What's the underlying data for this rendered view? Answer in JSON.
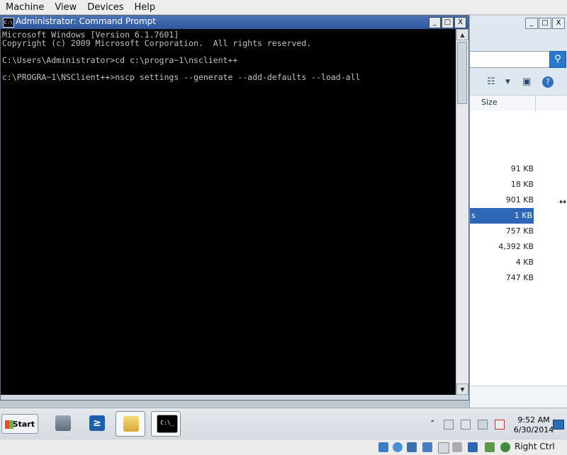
{
  "host_menu": [
    "Machine",
    "View",
    "Devices",
    "Help"
  ],
  "cmd": {
    "title": "Administrator: Command Prompt",
    "icon_text": "C:\\",
    "lines": [
      "Microsoft Windows [Version 6.1.7601]",
      "Copyright (c) 2009 Microsoft Corporation.  All rights reserved.",
      "",
      "C:\\Users\\Administrator>cd c:\\progra~1\\nsclient++",
      "",
      "c:\\PROGRA~1\\NSClient++>nscp settings --generate --add-defaults --load-all"
    ],
    "controls": [
      "_",
      "□",
      "X"
    ]
  },
  "explorer": {
    "controls": [
      "_",
      "□",
      "X"
    ],
    "size_header": "Size",
    "rows": [
      {
        "size": "91 KB",
        "selected": false
      },
      {
        "size": "18 KB",
        "selected": false
      },
      {
        "size": "901 KB",
        "selected": false
      },
      {
        "size": "1 KB",
        "selected": true,
        "prefix": "s"
      },
      {
        "size": "757 KB",
        "selected": false
      },
      {
        "size": "4,392 KB",
        "selected": false
      },
      {
        "size": "4 KB",
        "selected": false
      },
      {
        "size": "747 KB",
        "selected": false
      }
    ]
  },
  "taskbar": {
    "start_label": "Start",
    "clock_time": "9:52 AM",
    "clock_date": "6/30/2014",
    "cmd_button_text": "C:\\_"
  },
  "vm_status": {
    "host_key": "Right Ctrl"
  },
  "colors": {
    "title_bar": "#3a63a8",
    "console_bg": "#000000",
    "console_text": "#c0c0c0",
    "selection": "#2d67b6"
  }
}
